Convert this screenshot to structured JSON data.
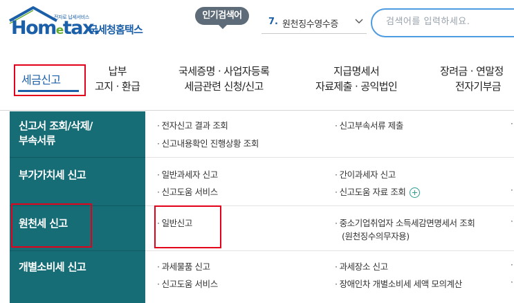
{
  "header": {
    "logo_tagline": "전자로 납세서비스",
    "logo_word_a": "Hom",
    "logo_word_e": "e",
    "logo_word_b": "tax.",
    "logo_korean": "국세청홈택스",
    "popular_label": "인기검색어",
    "popular_rank": "7.",
    "popular_term": "원천징수영수증",
    "search_placeholder": "검색어를 입력하세요."
  },
  "gnb": {
    "items": [
      {
        "line1": "세금신고",
        "line2": ""
      },
      {
        "line1": "납부",
        "line2": "고지 · 환급"
      },
      {
        "line1": "국세증명 · 사업자등록",
        "line2": "세금관련 신청/신고"
      },
      {
        "line1": "지급명세서",
        "line2": "자료제출 · 공익법인"
      },
      {
        "line1": "장려금 · 연말정",
        "line2": "전자기부금"
      }
    ],
    "active_index": 0
  },
  "menu": {
    "rows": [
      {
        "category": [
          "신고서 조회/삭제/",
          "부속서류"
        ],
        "col1": [
          "전자신고 결과 조회",
          "신고내용확인 진행상황 조회"
        ],
        "col2": [
          "신고부속서류 제출"
        ]
      },
      {
        "category": [
          "부가가치세 신고"
        ],
        "col1": [
          "일반과세자 신고",
          "신고도움 서비스"
        ],
        "col2": [
          "간이과세자 신고",
          "신고도움 자료 조회"
        ]
      },
      {
        "category": [
          "원천세 신고"
        ],
        "col1": [
          "일반신고"
        ],
        "col2": [
          "중소기업취업자 소득세감면명세서 조회"
        ],
        "col2_sub": "(원천징수의무자용)"
      },
      {
        "category": [
          "개별소비세 신고"
        ],
        "col1": [
          "과세물품 신고",
          "신고도움 서비스"
        ],
        "col2": [
          "과세장소 신고",
          "장애인차 개별소비세 세액 모의계산"
        ]
      }
    ]
  },
  "colors": {
    "brand_blue": "#1b5fa8",
    "brand_green": "#67ab2e",
    "sidebar_teal": "#176d76",
    "highlight_red": "#e3001b",
    "search_border": "#4d9be0"
  }
}
